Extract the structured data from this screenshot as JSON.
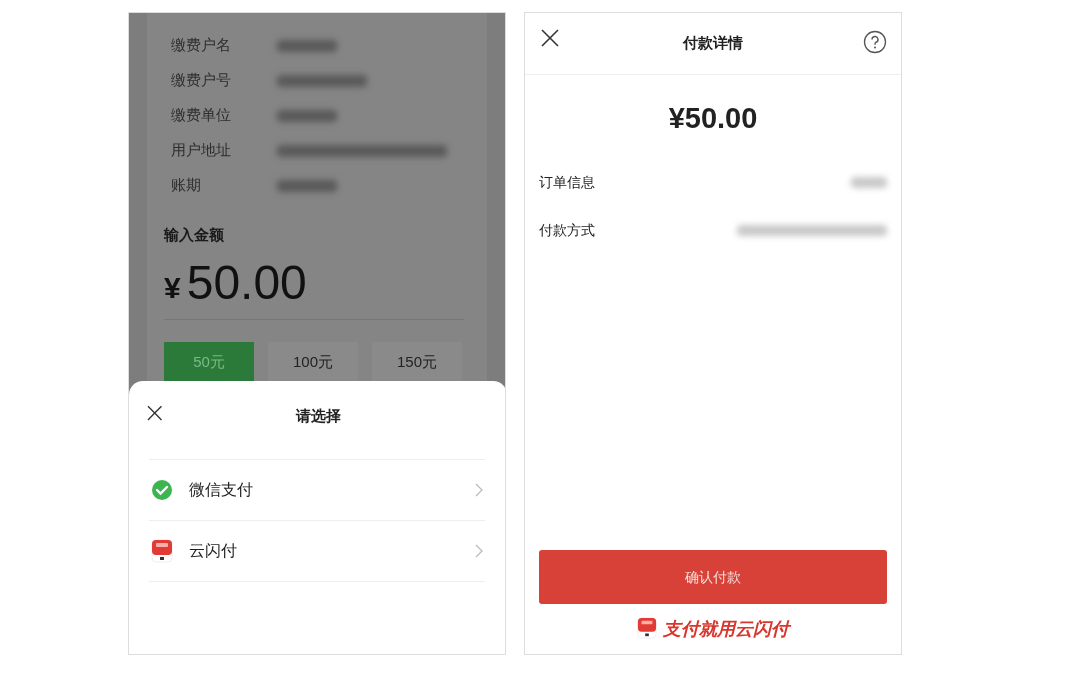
{
  "left_screen": {
    "info_rows": [
      {
        "label": "缴费户名"
      },
      {
        "label": "缴费户号"
      },
      {
        "label": "缴费单位"
      },
      {
        "label": "用户地址"
      },
      {
        "label": "账期"
      }
    ],
    "amount_label": "输入金额",
    "currency": "¥",
    "amount": "50.00",
    "amount_options": [
      {
        "label": "50元",
        "selected": true
      },
      {
        "label": "100元",
        "selected": false
      },
      {
        "label": "150元",
        "selected": false
      }
    ],
    "sheet": {
      "close": "×",
      "title": "请选择",
      "options": [
        {
          "kind": "wechat",
          "label": "微信支付"
        },
        {
          "kind": "unionpay",
          "label": "云闪付"
        }
      ]
    }
  },
  "right_screen": {
    "title": "付款详情",
    "amount": "¥50.00",
    "rows": [
      {
        "label": "订单信息"
      },
      {
        "label": "付款方式"
      }
    ],
    "confirm_button": "确认付款",
    "slogan": "支付就用云闪付"
  }
}
